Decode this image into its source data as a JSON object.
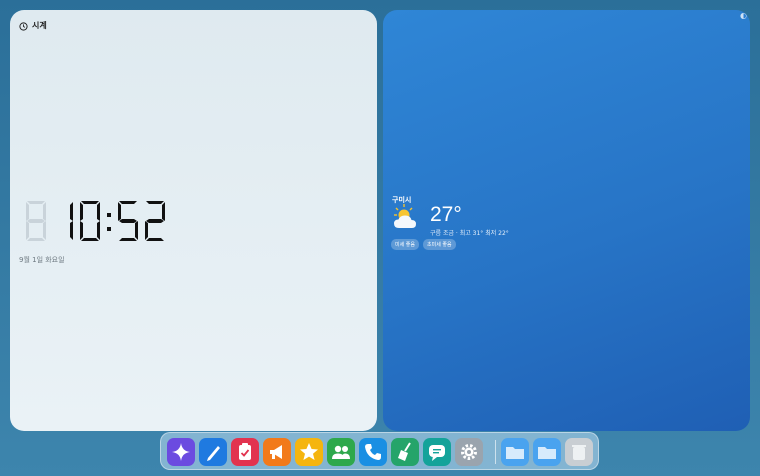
{
  "clock_widget": {
    "title": "시계",
    "hours": "10",
    "minutes": "52",
    "date": "9월 1일 화요일"
  },
  "weather_widget": {
    "city": "구미시",
    "temperature": "27°",
    "condition": "구름 조금 · 최고 31° 최저 22°",
    "chips": [
      "미세 좋음",
      "초미세 좋음"
    ]
  },
  "dock": {
    "apps": [
      {
        "name": "assistant",
        "icon": "sparkle-icon",
        "color": "#6b4be0"
      },
      {
        "name": "notes",
        "icon": "pen-icon",
        "color": "#1f7ae0"
      },
      {
        "name": "tasks",
        "icon": "clipboard-check-icon",
        "color": "#e2334f"
      },
      {
        "name": "announcements",
        "icon": "megaphone-icon",
        "color": "#f27a1a"
      },
      {
        "name": "favorites",
        "icon": "star-icon",
        "color": "#f5b50f"
      },
      {
        "name": "contacts",
        "icon": "people-icon",
        "color": "#2ea84c"
      },
      {
        "name": "phone",
        "icon": "phone-icon",
        "color": "#1a8fe3"
      },
      {
        "name": "cleaner",
        "icon": "broom-icon",
        "color": "#25a46a"
      },
      {
        "name": "messages",
        "icon": "chat-icon",
        "color": "#14a39a"
      },
      {
        "name": "settings",
        "icon": "gear-icon",
        "color": "#9aa4ae"
      },
      {
        "name": "folder-1",
        "icon": "folder-icon",
        "color": "#4aa3ef"
      },
      {
        "name": "folder-2",
        "icon": "folder-icon",
        "color": "#4aa3ef"
      },
      {
        "name": "trash",
        "icon": "trash-icon",
        "color": "#c9ced3"
      }
    ]
  },
  "colors": {
    "clock_bg": "#e5eef3",
    "weather_bg": "#2774c6",
    "desktop_bg": "#2f769e"
  }
}
